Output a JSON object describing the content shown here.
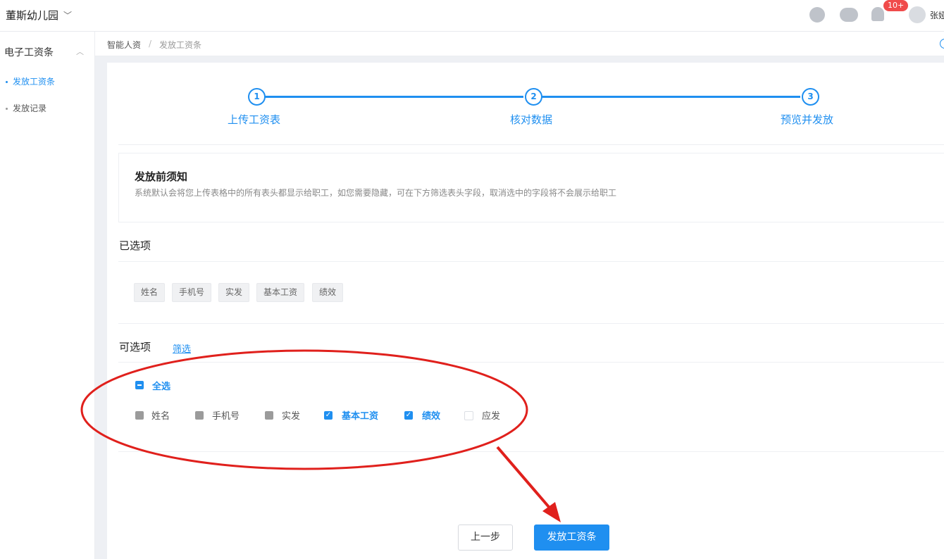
{
  "topbar": {
    "org_name": "董斯幼儿园",
    "notification_badge": "10+",
    "user_name": "张娅"
  },
  "sidebar": {
    "group_label": "电子工资条",
    "items": [
      {
        "label": "发放工资条",
        "active": true
      },
      {
        "label": "发放记录",
        "active": false
      }
    ]
  },
  "breadcrumb": {
    "items": [
      "智能人资",
      "发放工资条"
    ],
    "separator": "/"
  },
  "steps": [
    {
      "number": "1",
      "label": "上传工资表"
    },
    {
      "number": "2",
      "label": "核对数据"
    },
    {
      "number": "3",
      "label": "预览并发放"
    }
  ],
  "notice": {
    "title": "发放前须知",
    "text": "系统默认会将您上传表格中的所有表头都显示给职工，如您需要隐藏，可在下方筛选表头字段，取消选中的字段将不会展示给职工"
  },
  "selected_section": {
    "title": "已选项",
    "chips": [
      "姓名",
      "手机号",
      "实发",
      "基本工资",
      "绩效"
    ]
  },
  "options_section": {
    "title": "可选项",
    "filter_link": "筛选",
    "select_all_label": "全选",
    "options": [
      {
        "label": "姓名",
        "state": "locked"
      },
      {
        "label": "手机号",
        "state": "locked"
      },
      {
        "label": "实发",
        "state": "locked"
      },
      {
        "label": "基本工资",
        "state": "checked"
      },
      {
        "label": "绩效",
        "state": "checked"
      },
      {
        "label": "应发",
        "state": "unchecked"
      }
    ]
  },
  "actions": {
    "prev_label": "上一步",
    "submit_label": "发放工资条"
  },
  "colors": {
    "accent": "#1f8ff0",
    "annotation": "#e0201c",
    "badge": "#f04b4b"
  }
}
